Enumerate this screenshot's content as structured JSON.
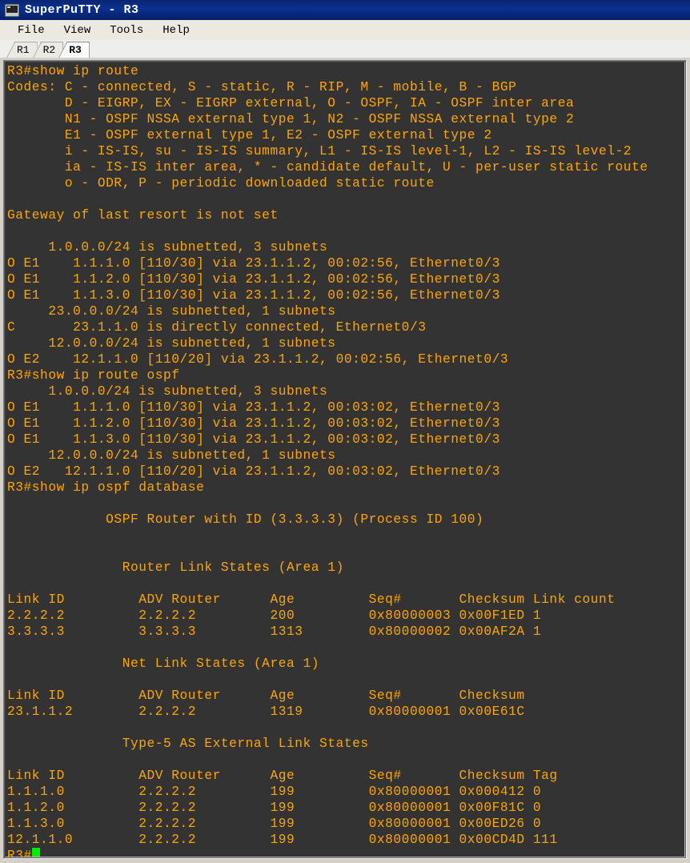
{
  "window": {
    "title": "SuperPuTTY - R3",
    "icon": "terminal-window-icon"
  },
  "menubar": {
    "items": [
      {
        "label": "File"
      },
      {
        "label": "View"
      },
      {
        "label": "Tools"
      },
      {
        "label": "Help"
      }
    ]
  },
  "tabs": {
    "items": [
      {
        "label": "R1",
        "active": false
      },
      {
        "label": "R2",
        "active": false
      },
      {
        "label": "R3",
        "active": true
      }
    ],
    "active_index": 2
  },
  "colors": {
    "terminal_background": "#333333",
    "terminal_foreground": "#ffa500",
    "cursor": "#00ee00",
    "titlebar": "#0b3090",
    "titlebar_text": "#ffffff",
    "chrome": "#d4d0c8",
    "menubar": "#ece9e0"
  },
  "terminal": {
    "prompt": "R3#",
    "cursor_visible": true,
    "lines": [
      "R3#show ip route",
      "Codes: C - connected, S - static, R - RIP, M - mobile, B - BGP",
      "       D - EIGRP, EX - EIGRP external, O - OSPF, IA - OSPF inter area",
      "       N1 - OSPF NSSA external type 1, N2 - OSPF NSSA external type 2",
      "       E1 - OSPF external type 1, E2 - OSPF external type 2",
      "       i - IS-IS, su - IS-IS summary, L1 - IS-IS level-1, L2 - IS-IS level-2",
      "       ia - IS-IS inter area, * - candidate default, U - per-user static route",
      "       o - ODR, P - periodic downloaded static route",
      "",
      "Gateway of last resort is not set",
      "",
      "     1.0.0.0/24 is subnetted, 3 subnets",
      "O E1    1.1.1.0 [110/30] via 23.1.1.2, 00:02:56, Ethernet0/3",
      "O E1    1.1.2.0 [110/30] via 23.1.1.2, 00:02:56, Ethernet0/3",
      "O E1    1.1.3.0 [110/30] via 23.1.1.2, 00:02:56, Ethernet0/3",
      "     23.0.0.0/24 is subnetted, 1 subnets",
      "C       23.1.1.0 is directly connected, Ethernet0/3",
      "     12.0.0.0/24 is subnetted, 1 subnets",
      "O E2    12.1.1.0 [110/20] via 23.1.1.2, 00:02:56, Ethernet0/3",
      "R3#show ip route ospf",
      "     1.0.0.0/24 is subnetted, 3 subnets",
      "O E1    1.1.1.0 [110/30] via 23.1.1.2, 00:03:02, Ethernet0/3",
      "O E1    1.1.2.0 [110/30] via 23.1.1.2, 00:03:02, Ethernet0/3",
      "O E1    1.1.3.0 [110/30] via 23.1.1.2, 00:03:02, Ethernet0/3",
      "     12.0.0.0/24 is subnetted, 1 subnets",
      "O E2   12.1.1.0 [110/20] via 23.1.1.2, 00:03:02, Ethernet0/3",
      "R3#show ip ospf database",
      "",
      "            OSPF Router with ID (3.3.3.3) (Process ID 100)",
      "",
      "",
      "              Router Link States (Area 1)",
      "",
      "Link ID         ADV Router      Age         Seq#       Checksum Link count",
      "2.2.2.2         2.2.2.2         200         0x80000003 0x00F1ED 1",
      "3.3.3.3         3.3.3.3         1313        0x80000002 0x00AF2A 1",
      "",
      "              Net Link States (Area 1)",
      "",
      "Link ID         ADV Router      Age         Seq#       Checksum",
      "23.1.1.2        2.2.2.2         1319        0x80000001 0x00E61C",
      "",
      "              Type-5 AS External Link States",
      "",
      "Link ID         ADV Router      Age         Seq#       Checksum Tag",
      "1.1.1.0         2.2.2.2         199         0x80000001 0x000412 0",
      "1.1.2.0         2.2.2.2         199         0x80000001 0x00F81C 0",
      "1.1.3.0         2.2.2.2         199         0x80000001 0x00ED26 0",
      "12.1.1.0        2.2.2.2         199         0x80000001 0x00CD4D 111"
    ],
    "ospf_database": {
      "router_id": "3.3.3.3",
      "process_id": "100",
      "sections": [
        {
          "title": "Router Link States (Area 1)",
          "headers": [
            "Link ID",
            "ADV Router",
            "Age",
            "Seq#",
            "Checksum",
            "Link count"
          ],
          "rows": [
            [
              "2.2.2.2",
              "2.2.2.2",
              "200",
              "0x80000003",
              "0x00F1ED",
              "1"
            ],
            [
              "3.3.3.3",
              "3.3.3.3",
              "1313",
              "0x80000002",
              "0x00AF2A",
              "1"
            ]
          ]
        },
        {
          "title": "Net Link States (Area 1)",
          "headers": [
            "Link ID",
            "ADV Router",
            "Age",
            "Seq#",
            "Checksum"
          ],
          "rows": [
            [
              "23.1.1.2",
              "2.2.2.2",
              "1319",
              "0x80000001",
              "0x00E61C"
            ]
          ]
        },
        {
          "title": "Type-5 AS External Link States",
          "headers": [
            "Link ID",
            "ADV Router",
            "Age",
            "Seq#",
            "Checksum",
            "Tag"
          ],
          "rows": [
            [
              "1.1.1.0",
              "2.2.2.2",
              "199",
              "0x80000001",
              "0x000412",
              "0"
            ],
            [
              "1.1.2.0",
              "2.2.2.2",
              "199",
              "0x80000001",
              "0x00F81C",
              "0"
            ],
            [
              "1.1.3.0",
              "2.2.2.2",
              "199",
              "0x80000001",
              "0x00ED26",
              "0"
            ],
            [
              "12.1.1.0",
              "2.2.2.2",
              "199",
              "0x80000001",
              "0x00CD4D",
              "111"
            ]
          ]
        }
      ]
    },
    "commands": [
      "show ip route",
      "show ip route ospf",
      "show ip ospf database"
    ]
  }
}
